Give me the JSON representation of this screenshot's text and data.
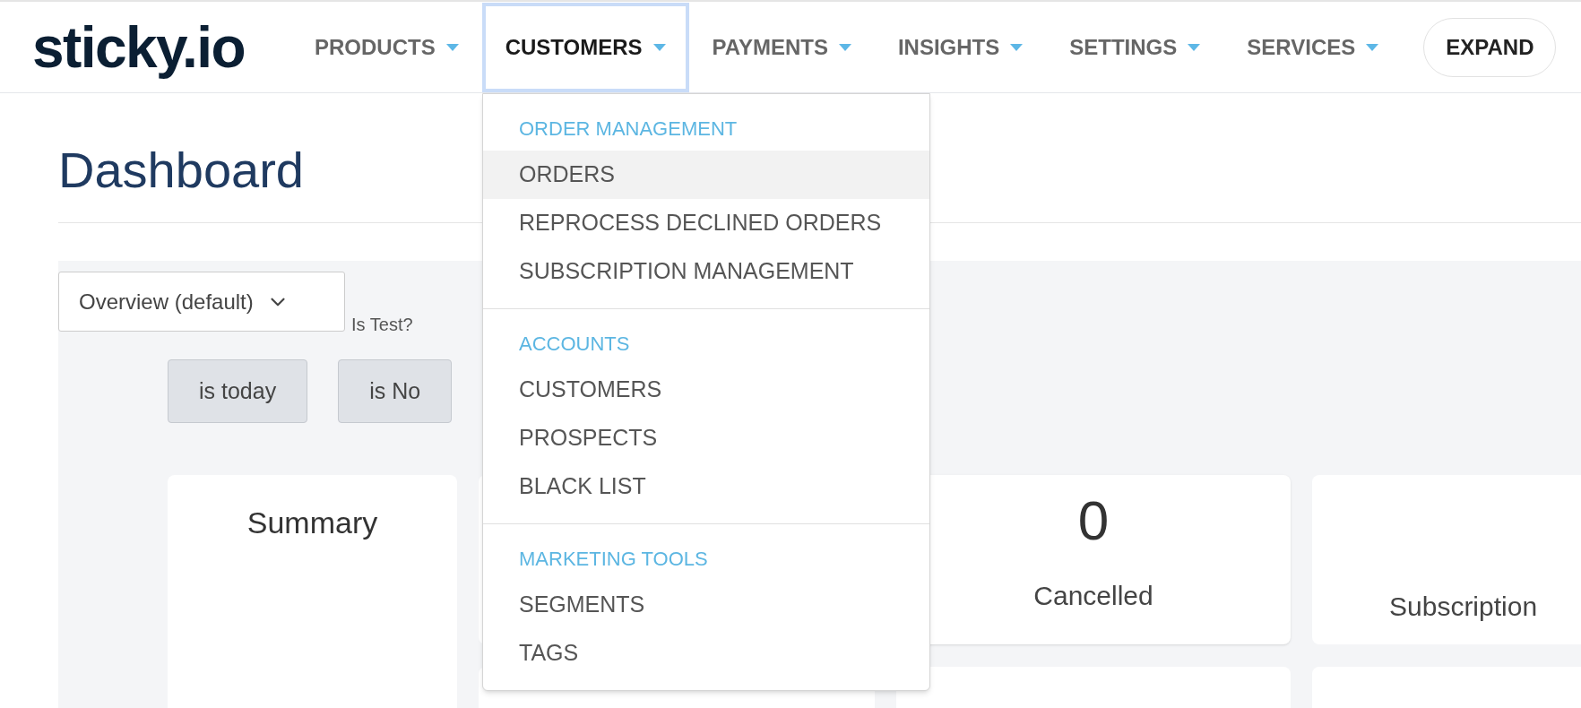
{
  "logo": "sticky.io",
  "nav": [
    {
      "label": "PRODUCTS",
      "selected": false
    },
    {
      "label": "CUSTOMERS",
      "selected": true
    },
    {
      "label": "PAYMENTS",
      "selected": false
    },
    {
      "label": "INSIGHTS",
      "selected": false
    },
    {
      "label": "SETTINGS",
      "selected": false
    },
    {
      "label": "SERVICES",
      "selected": false
    }
  ],
  "expand_button": "EXPAND",
  "dropdown": [
    {
      "heading": "ORDER MANAGEMENT",
      "items": [
        {
          "label": "ORDERS",
          "hovered": true
        },
        {
          "label": "REPROCESS DECLINED ORDERS",
          "hovered": false
        },
        {
          "label": "SUBSCRIPTION MANAGEMENT",
          "hovered": false
        }
      ]
    },
    {
      "heading": "ACCOUNTS",
      "items": [
        {
          "label": "CUSTOMERS",
          "hovered": false
        },
        {
          "label": "PROSPECTS",
          "hovered": false
        },
        {
          "label": "BLACK LIST",
          "hovered": false
        }
      ]
    },
    {
      "heading": "MARKETING TOOLS",
      "items": [
        {
          "label": "SEGMENTS",
          "hovered": false
        },
        {
          "label": "TAGS",
          "hovered": false
        }
      ]
    }
  ],
  "page_title": "Dashboard",
  "view_select": {
    "value": "Overview (default)"
  },
  "filter_label": "Is Test?",
  "filters": [
    "is today",
    "is No"
  ],
  "cards": [
    {
      "title": "Summary"
    },
    {
      "value": "0",
      "label": "Cancelled"
    },
    {
      "label": "Subscription"
    }
  ]
}
